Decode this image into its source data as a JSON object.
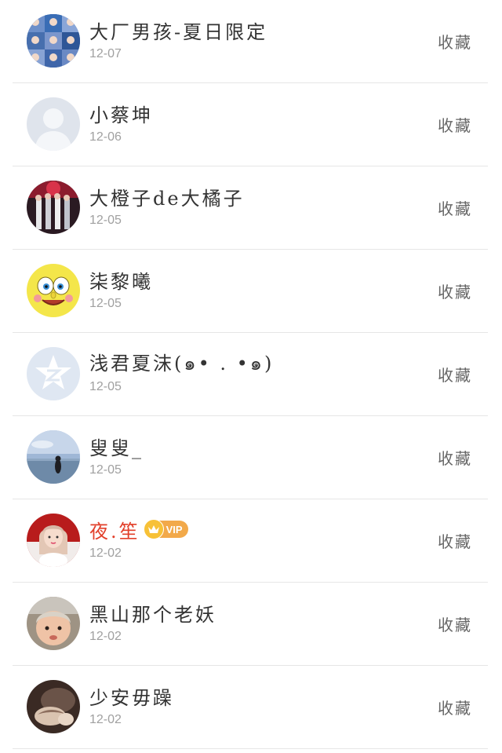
{
  "rows": [
    {
      "name": "大厂男孩-夏日限定",
      "date": "12-07",
      "action": "收藏",
      "avatar_icon": "group-photo-avatar"
    },
    {
      "name": "小蔡坤",
      "date": "12-06",
      "action": "收藏",
      "avatar_icon": "default-user-avatar"
    },
    {
      "name": "大橙子de大橘子",
      "date": "12-05",
      "action": "收藏",
      "avatar_icon": "band-photo-avatar"
    },
    {
      "name": "柒黎曦",
      "date": "12-05",
      "action": "收藏",
      "avatar_icon": "spongebob-avatar"
    },
    {
      "name": "浅君夏沫(๑• . •๑)",
      "date": "12-05",
      "action": "收藏",
      "avatar_icon": "qzone-star-avatar"
    },
    {
      "name": "叟叟_",
      "date": "12-05",
      "action": "收藏",
      "avatar_icon": "seaside-avatar"
    },
    {
      "name": "夜.笙",
      "date": "12-02",
      "action": "收藏",
      "avatar_icon": "girl-photo-avatar",
      "vip": "VIP",
      "name_color": "#e2402b"
    },
    {
      "name": "黑山那个老妖",
      "date": "12-02",
      "action": "收藏",
      "avatar_icon": "baby-photo-avatar"
    },
    {
      "name": "少安毋躁",
      "date": "12-02",
      "action": "收藏",
      "avatar_icon": "dark-photo-avatar"
    }
  ]
}
